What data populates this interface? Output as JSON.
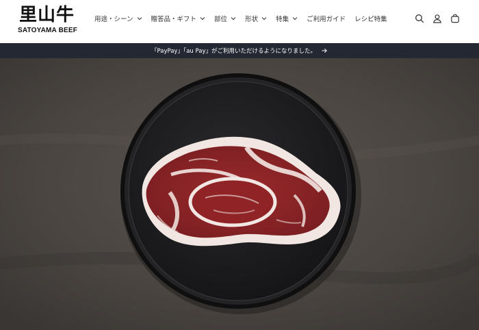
{
  "brand": {
    "logo_kanji": "里山牛",
    "logo_sub": "SATOYAMA BEEF"
  },
  "nav": {
    "items": [
      {
        "label": "用途・シーン",
        "has_dropdown": true
      },
      {
        "label": "贈答品・ギフト",
        "has_dropdown": true
      },
      {
        "label": "部位",
        "has_dropdown": true
      },
      {
        "label": "形状",
        "has_dropdown": true
      },
      {
        "label": "特集",
        "has_dropdown": true
      },
      {
        "label": "ご利用ガイド",
        "has_dropdown": false
      },
      {
        "label": "レシピ特集",
        "has_dropdown": false
      }
    ]
  },
  "header_icons": [
    "search-icon",
    "account-icon",
    "cart-icon"
  ],
  "announcement": {
    "text": "「PayPay」「au Pay」がご利用いただけるようになりました。"
  },
  "colors": {
    "announcement_bg": "#242833",
    "text": "#333333",
    "hero_bg": "#4a4541",
    "plate": "#1c1c1e"
  }
}
